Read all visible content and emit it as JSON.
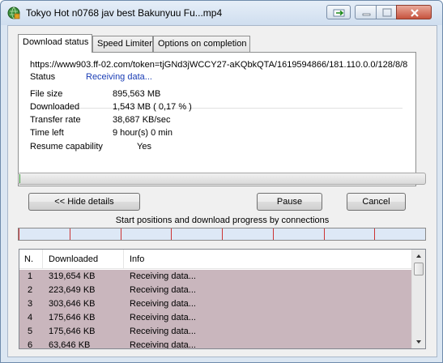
{
  "window": {
    "title": "Tokyo Hot n0768 jav best Bakunyuu Fu...mp4"
  },
  "tabs": [
    {
      "label": "Download status",
      "active": true
    },
    {
      "label": "Speed Limiter",
      "active": false
    },
    {
      "label": "Options on completion",
      "active": false
    }
  ],
  "status": {
    "url": "https://www903.ff-02.com/token=tjGNd3jWCCY27-aKQbkQTA/1619594866/181.110.0.0/128/8/8",
    "status_label": "Status",
    "status_value": "Receiving data...",
    "file_size_label": "File size",
    "file_size_value": "895,563  MB",
    "downloaded_label": "Downloaded",
    "downloaded_value": "1,543  MB  ( 0,17 % )",
    "transfer_rate_label": "Transfer rate",
    "transfer_rate_value": "38,687  KB/sec",
    "time_left_label": "Time left",
    "time_left_value": "9 hour(s) 0 min",
    "resume_label": "Resume capability",
    "resume_value": "Yes"
  },
  "progress": {
    "fraction": 0.0017
  },
  "buttons": {
    "hide_details": "<< Hide details",
    "pause": "Pause",
    "cancel": "Cancel"
  },
  "connections": {
    "title": "Start positions and download progress by connections",
    "count": 8,
    "header": {
      "no": "N.",
      "downloaded": "Downloaded",
      "info": "Info"
    },
    "rows": [
      {
        "no": "1",
        "downloaded": "319,654  KB",
        "info": "Receiving data..."
      },
      {
        "no": "2",
        "downloaded": "223,649  KB",
        "info": "Receiving data..."
      },
      {
        "no": "3",
        "downloaded": "303,646  KB",
        "info": "Receiving data..."
      },
      {
        "no": "4",
        "downloaded": "175,646  KB",
        "info": "Receiving data..."
      },
      {
        "no": "5",
        "downloaded": "175,646  KB",
        "info": "Receiving data..."
      },
      {
        "no": "6",
        "downloaded": "63,646  KB",
        "info": "Receiving data..."
      }
    ]
  },
  "colors": {
    "accent_status": "#1a3db5",
    "row_highlight": "#c9b6bd",
    "connection_tick": "#cc3333"
  },
  "icons": {
    "app": "idm-globe-icon",
    "export": "arrow-right-icon",
    "minimize": "minimize-icon",
    "maximize": "maximize-icon",
    "close": "close-icon"
  }
}
